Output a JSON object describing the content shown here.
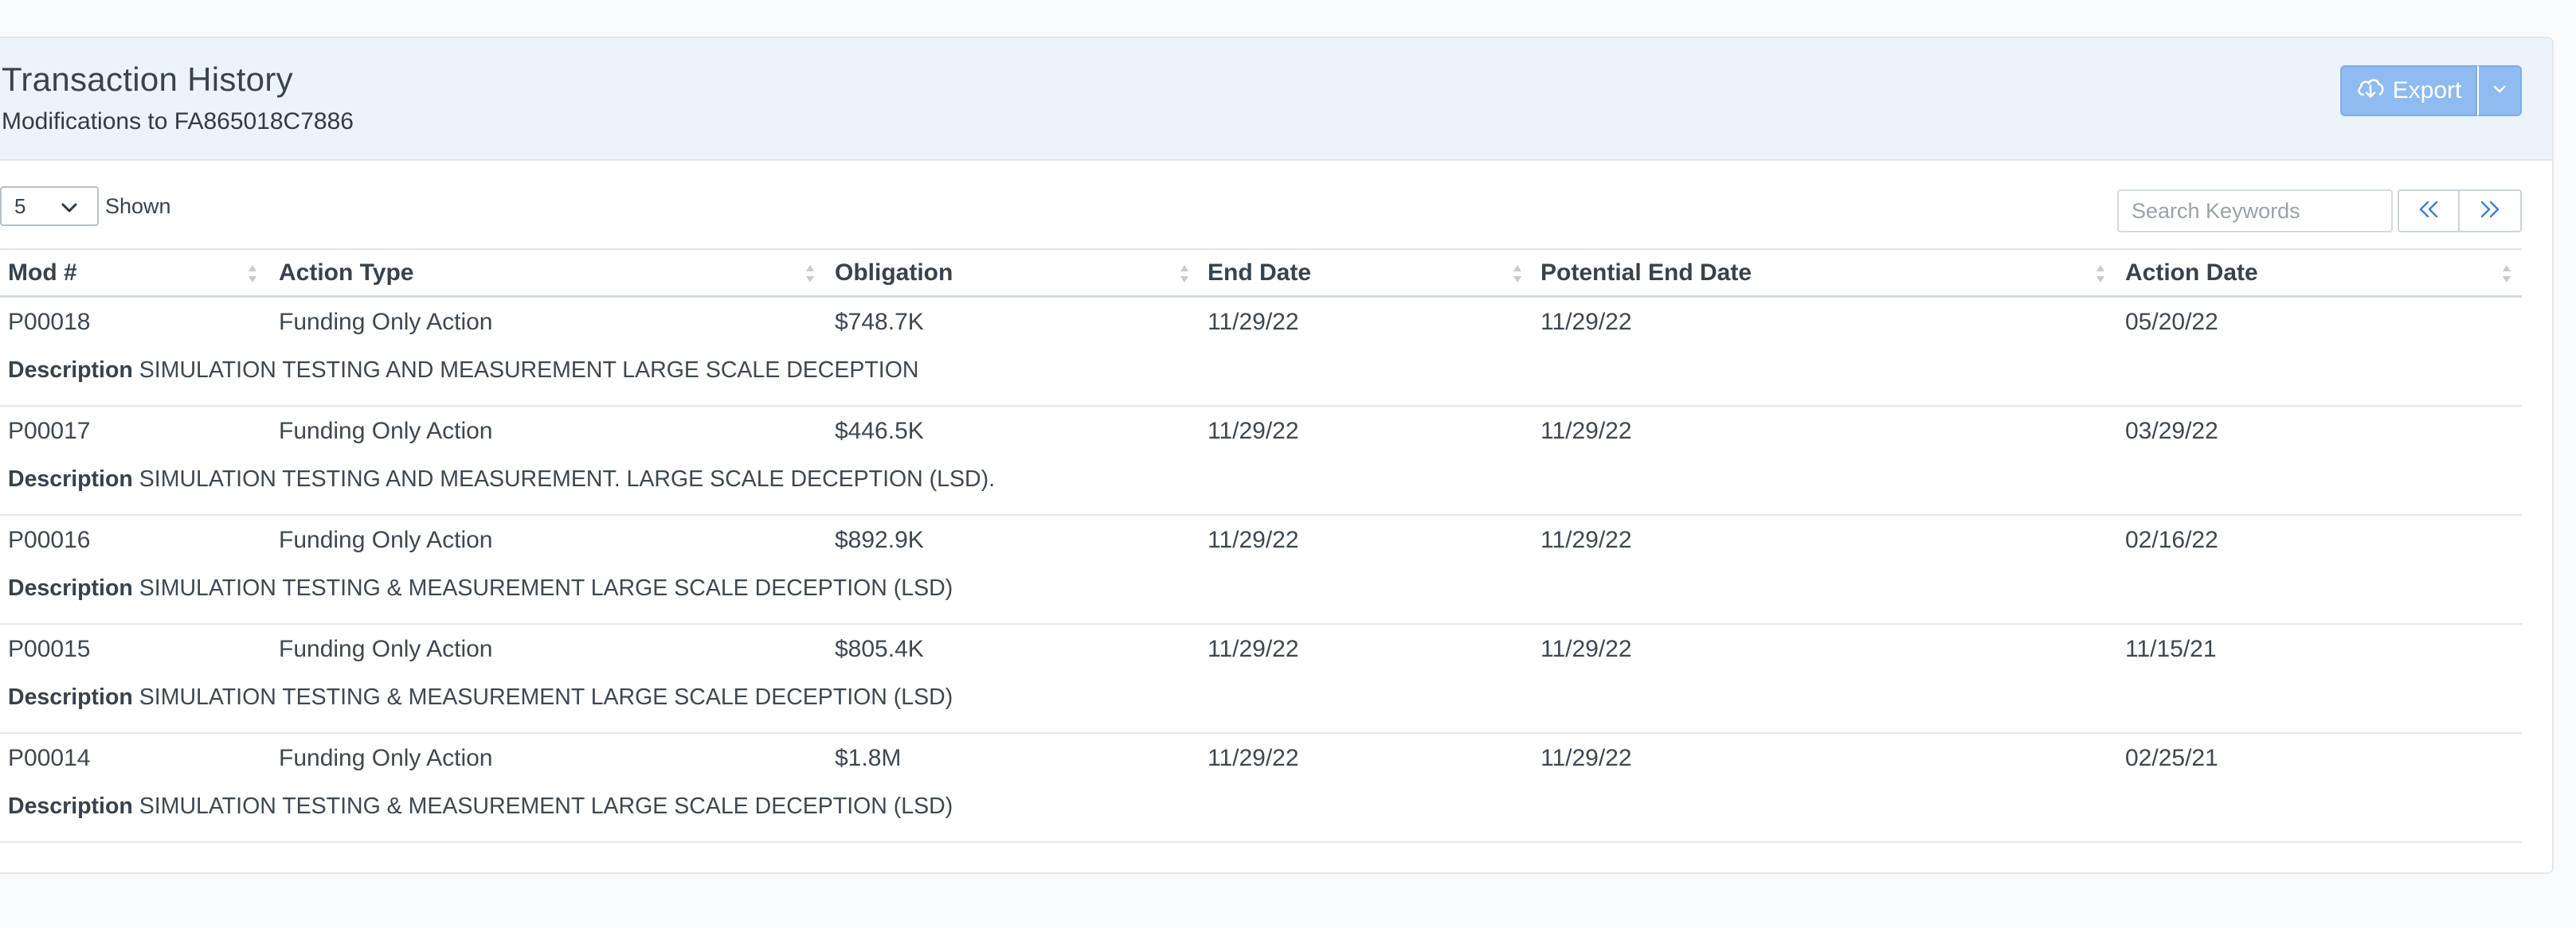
{
  "header": {
    "title": "Transaction History",
    "subtitle": "Modifications to FA865018C7886",
    "export_label": "Export"
  },
  "controls": {
    "page_size": "5",
    "shown_label": "Shown",
    "search_placeholder": "Search Keywords"
  },
  "table": {
    "columns": [
      "Mod #",
      "Action Type",
      "Obligation",
      "End Date",
      "Potential End Date",
      "Action Date"
    ],
    "description_label": "Description",
    "rows": [
      {
        "mod": "P00018",
        "action_type": "Funding Only Action",
        "obligation": "$748.7K",
        "end_date": "11/29/22",
        "potential_end_date": "11/29/22",
        "action_date": "05/20/22",
        "description": "SIMULATION TESTING AND MEASUREMENT LARGE SCALE DECEPTION"
      },
      {
        "mod": "P00017",
        "action_type": "Funding Only Action",
        "obligation": "$446.5K",
        "end_date": "11/29/22",
        "potential_end_date": "11/29/22",
        "action_date": "03/29/22",
        "description": "SIMULATION TESTING AND MEASUREMENT. LARGE SCALE DECEPTION (LSD)."
      },
      {
        "mod": "P00016",
        "action_type": "Funding Only Action",
        "obligation": "$892.9K",
        "end_date": "11/29/22",
        "potential_end_date": "11/29/22",
        "action_date": "02/16/22",
        "description": "SIMULATION TESTING & MEASUREMENT LARGE SCALE DECEPTION (LSD)"
      },
      {
        "mod": "P00015",
        "action_type": "Funding Only Action",
        "obligation": "$805.4K",
        "end_date": "11/29/22",
        "potential_end_date": "11/29/22",
        "action_date": "11/15/21",
        "description": "SIMULATION TESTING & MEASUREMENT LARGE SCALE DECEPTION (LSD)"
      },
      {
        "mod": "P00014",
        "action_type": "Funding Only Action",
        "obligation": "$1.8M",
        "end_date": "11/29/22",
        "potential_end_date": "11/29/22",
        "action_date": "02/25/21",
        "description": "SIMULATION TESTING & MEASUREMENT LARGE SCALE DECEPTION (LSD)"
      }
    ]
  },
  "icons": {
    "export": "cloud-download-icon",
    "dropdown": "chevron-down-icon",
    "prev": "double-chevron-left-icon",
    "next": "double-chevron-right-icon",
    "sort": "sort-icon"
  },
  "colors": {
    "header_bg": "#edf3fb",
    "export_button": "#8fbbf0",
    "pager_icon": "#3d7fd1"
  }
}
